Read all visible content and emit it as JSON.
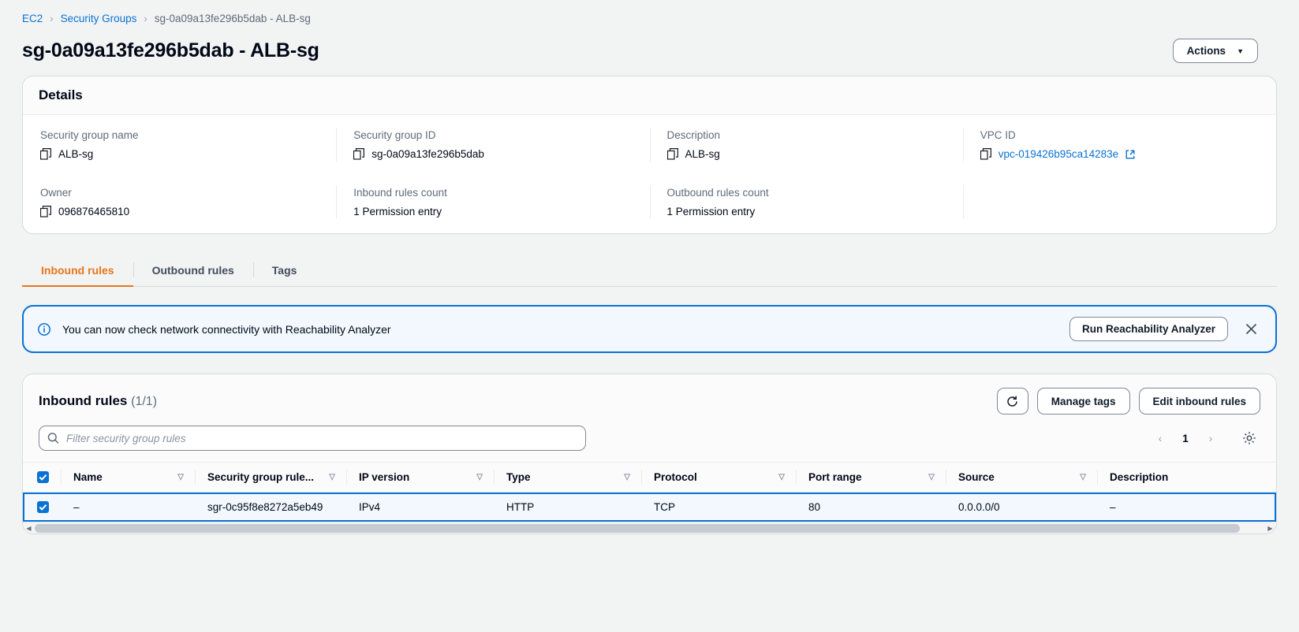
{
  "breadcrumb": {
    "items": [
      {
        "label": "EC2",
        "type": "link"
      },
      {
        "label": "Security Groups",
        "type": "link"
      },
      {
        "label": "sg-0a09a13fe296b5dab - ALB-sg",
        "type": "current"
      }
    ],
    "separator": "›"
  },
  "header": {
    "title": "sg-0a09a13fe296b5dab - ALB-sg",
    "actions_label": "Actions",
    "actions_caret": "▼"
  },
  "details": {
    "section_title": "Details",
    "fields": [
      {
        "label": "Security group name",
        "value": "ALB-sg",
        "copyable": true
      },
      {
        "label": "Security group ID",
        "value": "sg-0a09a13fe296b5dab",
        "copyable": true
      },
      {
        "label": "Description",
        "value": "ALB-sg",
        "copyable": true
      },
      {
        "label": "VPC ID",
        "value": "vpc-019426b95ca14283e",
        "copyable": true,
        "link": true
      },
      {
        "label": "Owner",
        "value": "096876465810",
        "copyable": true
      },
      {
        "label": "Inbound rules count",
        "value": "1 Permission entry",
        "copyable": false
      },
      {
        "label": "Outbound rules count",
        "value": "1 Permission entry",
        "copyable": false
      }
    ]
  },
  "tabs": [
    {
      "label": "Inbound rules",
      "active": true
    },
    {
      "label": "Outbound rules",
      "active": false
    },
    {
      "label": "Tags",
      "active": false
    }
  ],
  "banner": {
    "icon": "info-icon",
    "text": "You can now check network connectivity with Reachability Analyzer",
    "button_label": "Run Reachability Analyzer",
    "close_icon": "close-icon"
  },
  "rules_panel": {
    "title": "Inbound rules",
    "count": "(1/1)",
    "refresh_icon": "refresh-icon",
    "manage_tags_label": "Manage tags",
    "edit_rules_label": "Edit inbound rules",
    "search": {
      "placeholder": "Filter security group rules",
      "value": "",
      "icon": "search-icon"
    },
    "pagination": {
      "prev": "‹",
      "page": "1",
      "next": "›",
      "settings_icon": "gear-icon"
    },
    "columns": [
      "Name",
      "Security group rule...",
      "IP version",
      "Type",
      "Protocol",
      "Port range",
      "Source",
      "Description"
    ],
    "rows": [
      {
        "selected": true,
        "name": "–",
        "rule_id": "sgr-0c95f8e8272a5eb49",
        "ip_version": "IPv4",
        "type": "HTTP",
        "protocol": "TCP",
        "port_range": "80",
        "source": "0.0.0.0/0",
        "description": "–"
      }
    ]
  },
  "colors": {
    "link": "#0972d3",
    "active_tab": "#e7761b",
    "banner_border": "#0972d3",
    "banner_bg": "#f2f8fd",
    "page_bg": "#f2f3f3"
  }
}
